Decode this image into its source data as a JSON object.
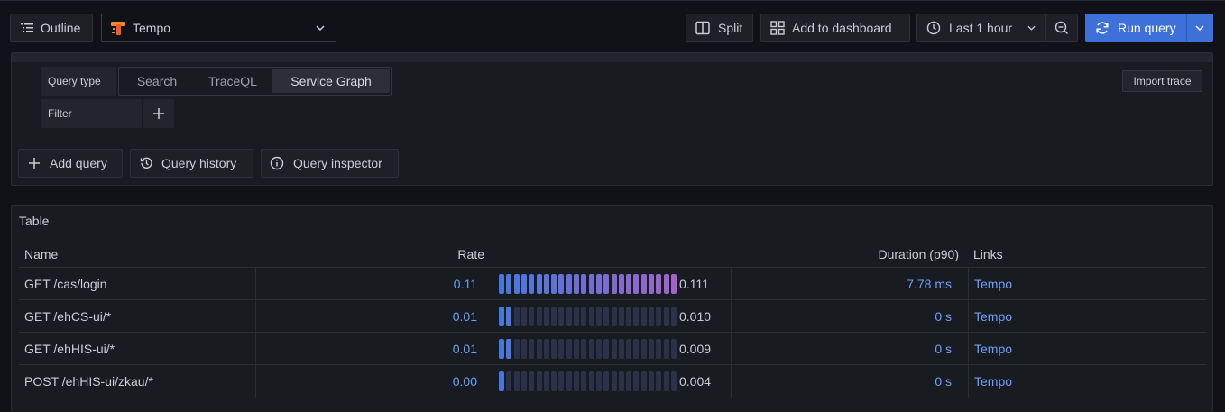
{
  "toolbar": {
    "outline_label": "Outline",
    "datasource": "Tempo",
    "split_label": "Split",
    "add_dashboard_label": "Add to dashboard",
    "time_range": "Last 1 hour",
    "run_query_label": "Run query"
  },
  "query": {
    "query_type_label": "Query type",
    "options": [
      "Search",
      "TraceQL",
      "Service Graph"
    ],
    "selected": "Service Graph",
    "filter_label": "Filter",
    "import_trace_label": "Import trace"
  },
  "actions": {
    "add_query": "Add query",
    "query_history": "Query history",
    "query_inspector": "Query inspector"
  },
  "table": {
    "title": "Table",
    "columns": [
      "Name",
      "Rate",
      "Duration (p90)",
      "Links"
    ],
    "rows": [
      {
        "name": "GET /cas/login",
        "rate": "0.11",
        "gauge_value": 0.111,
        "gauge_text": "0.111",
        "duration": "7.78 ms",
        "link": "Tempo"
      },
      {
        "name": "GET /ehCS-ui/*",
        "rate": "0.01",
        "gauge_value": 0.01,
        "gauge_text": "0.010",
        "duration": "0 s",
        "link": "Tempo"
      },
      {
        "name": "GET /ehHIS-ui/*",
        "rate": "0.01",
        "gauge_value": 0.009,
        "gauge_text": "0.009",
        "duration": "0 s",
        "link": "Tempo"
      },
      {
        "name": "POST /ehHIS-ui/zkau/*",
        "rate": "0.00",
        "gauge_value": 0.004,
        "gauge_text": "0.004",
        "duration": "0 s",
        "link": "Tempo"
      }
    ]
  },
  "colors": {
    "accent": "#3d71d9",
    "link": "#6e9fff",
    "gauge_empty": "#2a3148"
  }
}
